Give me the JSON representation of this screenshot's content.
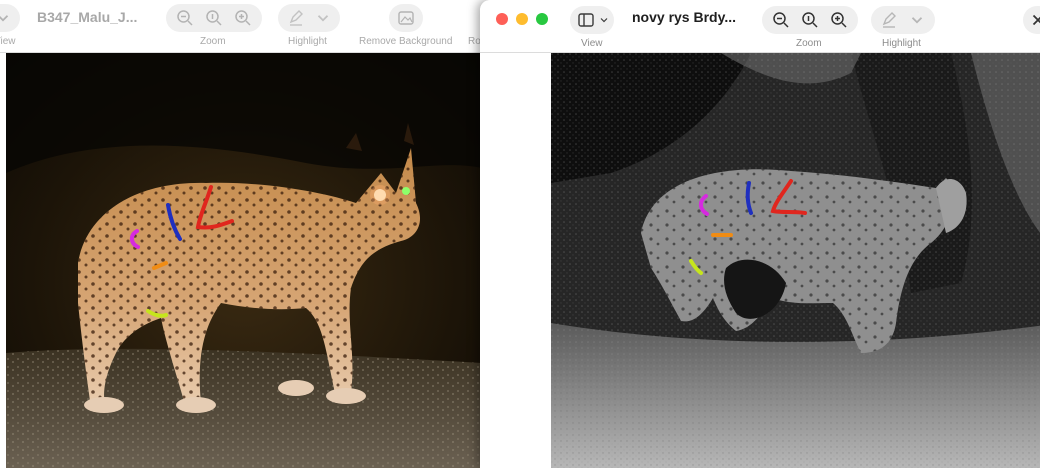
{
  "back_window": {
    "title": "B347_Malu_J...",
    "captions": {
      "view": "View",
      "zoom": "Zoom",
      "highlight": "Highlight",
      "remove_background": "Remove Background",
      "rotate": "Ro"
    },
    "image": {
      "description": "Night color trail-camera photo of a Eurasian lynx walking on a gravel path with colored annotation strokes"
    }
  },
  "front_window": {
    "title": "novy rys Brdy...",
    "captions": {
      "view": "View",
      "zoom": "Zoom",
      "highlight": "Highlight"
    },
    "image": {
      "description": "Black-and-white infrared trail-camera photo of a lynx with colored annotation strokes"
    }
  },
  "colors": {
    "close": "#fe5f57",
    "minimize": "#febc2e",
    "maximize": "#28c840",
    "annotation_magenta": "#d62adf",
    "annotation_blue": "#1f2fbf",
    "annotation_red": "#e0261e",
    "annotation_orange": "#f08c14",
    "annotation_yellow": "#c6e51c"
  },
  "icons": [
    "sidebar-toggle-icon",
    "chevron-down-icon",
    "zoom-out-icon",
    "actual-size-icon",
    "zoom-in-icon",
    "highlight-pen-icon",
    "remove-background-icon",
    "close-icon"
  ]
}
